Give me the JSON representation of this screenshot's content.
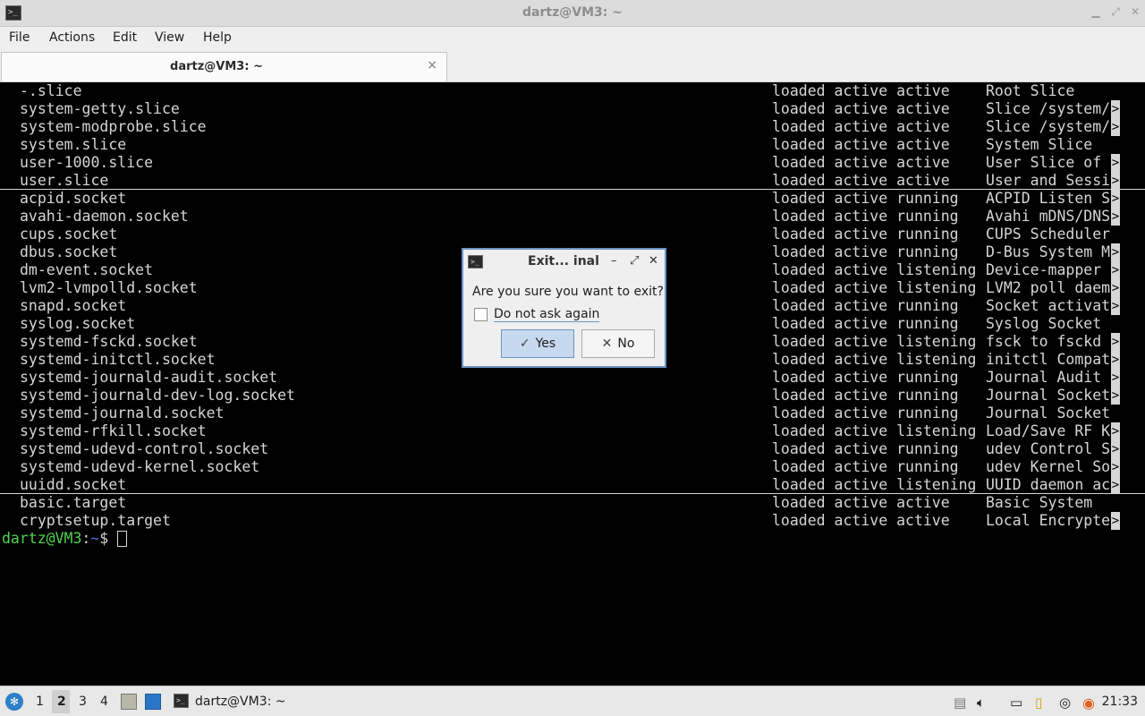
{
  "window": {
    "title": "dartz@VM3: ~",
    "icon": "terminal-icon",
    "controls": [
      "minimize",
      "maximize",
      "close"
    ]
  },
  "menubar": {
    "items": [
      "File",
      "Actions",
      "Edit",
      "View",
      "Help"
    ]
  },
  "tabs": [
    {
      "label": "dartz@VM3: ~",
      "close": "×"
    }
  ],
  "terminal": {
    "lines": [
      {
        "unit": "-.slice",
        "state": "loaded active active",
        "desc": "Root Slice",
        "more": false
      },
      {
        "unit": "system-getty.slice",
        "state": "loaded active active",
        "desc": "Slice /system/",
        "more": true
      },
      {
        "unit": "system-modprobe.slice",
        "state": "loaded active active",
        "desc": "Slice /system/",
        "more": true
      },
      {
        "unit": "system.slice",
        "state": "loaded active active",
        "desc": "System Slice",
        "more": false
      },
      {
        "unit": "user-1000.slice",
        "state": "loaded active active",
        "desc": "User Slice of",
        "more": true
      },
      {
        "unit": "user.slice",
        "state": "loaded active active",
        "desc": "User and Sessi",
        "more": true
      },
      {
        "unit": "acpid.socket",
        "state": "loaded active running",
        "desc": "ACPID Listen S",
        "more": true
      },
      {
        "unit": "avahi-daemon.socket",
        "state": "loaded active running",
        "desc": "Avahi mDNS/DNS",
        "more": true
      },
      {
        "unit": "cups.socket",
        "state": "loaded active running",
        "desc": "CUPS Scheduler",
        "more": false
      },
      {
        "unit": "dbus.socket",
        "state": "loaded active running",
        "desc": "D-Bus System M",
        "more": true
      },
      {
        "unit": "dm-event.socket",
        "state": "loaded active listening",
        "desc": "Device-mapper",
        "more": true
      },
      {
        "unit": "lvm2-lvmpolld.socket",
        "state": "loaded active listening",
        "desc": "LVM2 poll daem",
        "more": true
      },
      {
        "unit": "snapd.socket",
        "state": "loaded active running",
        "desc": "Socket activat",
        "more": true
      },
      {
        "unit": "syslog.socket",
        "state": "loaded active running",
        "desc": "Syslog Socket",
        "more": false
      },
      {
        "unit": "systemd-fsckd.socket",
        "state": "loaded active listening",
        "desc": "fsck to fsckd",
        "more": true
      },
      {
        "unit": "systemd-initctl.socket",
        "state": "loaded active listening",
        "desc": "initctl Compat",
        "more": true
      },
      {
        "unit": "systemd-journald-audit.socket",
        "state": "loaded active running",
        "desc": "Journal Audit",
        "more": true
      },
      {
        "unit": "systemd-journald-dev-log.socket",
        "state": "loaded active running",
        "desc": "Journal Socket",
        "more": true
      },
      {
        "unit": "systemd-journald.socket",
        "state": "loaded active running",
        "desc": "Journal Socket",
        "more": false
      },
      {
        "unit": "systemd-rfkill.socket",
        "state": "loaded active listening",
        "desc": "Load/Save RF K",
        "more": true
      },
      {
        "unit": "systemd-udevd-control.socket",
        "state": "loaded active running",
        "desc": "udev Control S",
        "more": true
      },
      {
        "unit": "systemd-udevd-kernel.socket",
        "state": "loaded active running",
        "desc": "udev Kernel So",
        "more": true
      },
      {
        "unit": "uuidd.socket",
        "state": "loaded active listening",
        "desc": "UUID daemon ac",
        "more": true
      },
      {
        "unit": "basic.target",
        "state": "loaded active active",
        "desc": "Basic System",
        "more": false
      },
      {
        "unit": "cryptsetup.target",
        "state": "loaded active active",
        "desc": "Local Encrypte",
        "more": true
      }
    ],
    "more_glyph": ">",
    "prompt": {
      "user": "dartz@VM3",
      "sep": ":",
      "path": "~",
      "symbol": "$ "
    }
  },
  "dialog": {
    "title": "Exit... inal",
    "message": "Are you sure you want to exit?",
    "checkbox_label": "Do not ask again",
    "checkbox_checked": false,
    "yes_label": "Yes",
    "no_label": "No"
  },
  "taskbar": {
    "workspaces": [
      "1",
      "2",
      "3",
      "4"
    ],
    "active_workspace": "2",
    "app_label": "dartz@VM3: ~",
    "clock": "21:33",
    "tray_icons": [
      "clipboard-icon",
      "volume-icon",
      "network-icon",
      "notes-icon",
      "update-icon",
      "ubuntu-icon"
    ]
  },
  "colors": {
    "prompt_user": "#4fd34f",
    "prompt_path": "#4d6cd8",
    "dialog_border": "#6b94c4",
    "terminal_bg": "#000000"
  }
}
